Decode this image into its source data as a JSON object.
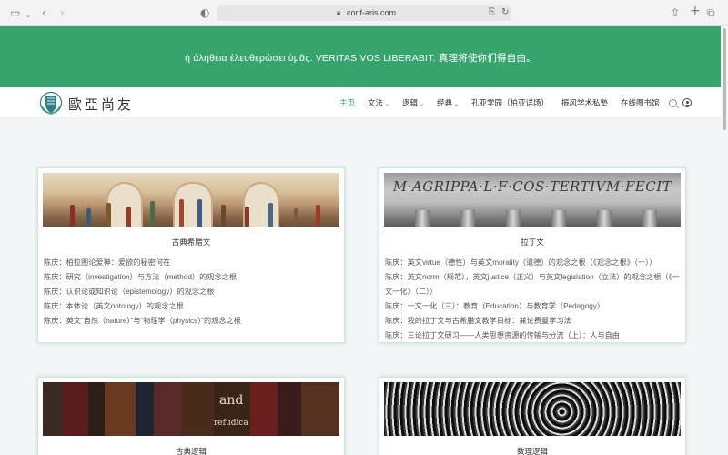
{
  "browser": {
    "url": "conf-aris.com"
  },
  "banner": {
    "motto": "ἡ ἀλήθεια ἐλευθερώσει ὑμᾶς.   VERITAS VOS LIBERABIT.   真理将使你们得自由。"
  },
  "site": {
    "logo_text": "歐亞尚友"
  },
  "nav": {
    "items": [
      {
        "label": "主页",
        "active": true,
        "dropdown": false
      },
      {
        "label": "文法",
        "active": false,
        "dropdown": true
      },
      {
        "label": "逻辑",
        "active": false,
        "dropdown": true
      },
      {
        "label": "经典",
        "active": false,
        "dropdown": true
      },
      {
        "label": "孔亚学园（柏亚详场）",
        "active": false,
        "dropdown": false
      },
      {
        "label": "振风学术私塾",
        "active": false,
        "dropdown": false
      },
      {
        "label": "在线图书馆",
        "active": false,
        "dropdown": false
      }
    ]
  },
  "cards": [
    {
      "title": "古典希腊文",
      "links": [
        "陈庆：柏拉图论爱神：爱欲的秘密何在",
        "陈庆：研究（investigation）与方法（method）的观念之根",
        "陈庆：认识论或知识论（epistemology）的观念之根",
        "陈庆：本体论（英文ontology）的观念之根",
        "陈庆：英文“自然（nature）”与“物理学（physics）”的观念之根"
      ]
    },
    {
      "title": "拉丁文",
      "image_text": "M·AGRIPPA·L·F·COS·TERTIVM·FECIT",
      "links": [
        "陈庆：英文virtue（德性）与英文morality（道德）的观念之根（《观念之根》（一））",
        "陈庆：英文norm（规范），英文justice（正义）与英文legislation（立法）的观念之根（《一文一化》（二））",
        "陈庆：一文一化（三）：教育（Education）与教育学（Pedagogy）",
        "陈庆：我的拉丁文与古希腊文教学目标：兼论费曼学习法",
        "陈庆：三论拉丁文研习——人类思想资源的传输与分流（上）：人与自由"
      ]
    },
    {
      "title": "古典逻辑",
      "image_text": [
        "and",
        "refudica"
      ]
    },
    {
      "title": "数理逻辑"
    }
  ],
  "colors": {
    "brand_green": "#36a46d",
    "card_border": "#cfe7d8"
  }
}
